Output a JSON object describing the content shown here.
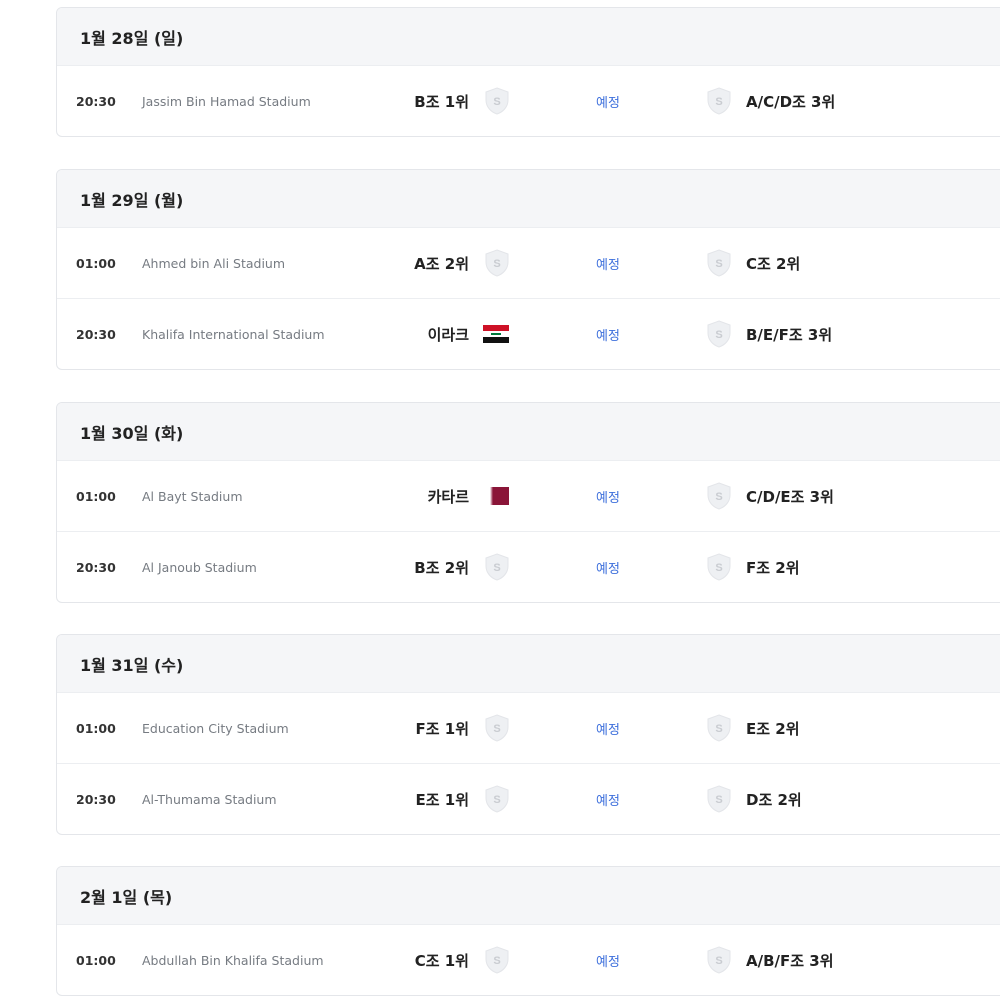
{
  "days": [
    {
      "date_label": "1월 28일 (일)",
      "matches": [
        {
          "time": "20:30",
          "stadium": "Jassim Bin Hamad Stadium",
          "home": "B조 1위",
          "home_icon": "shield-placeholder",
          "status": "예정",
          "away": "A/C/D조 3위",
          "away_icon": "shield-placeholder"
        }
      ]
    },
    {
      "date_label": "1월 29일 (월)",
      "matches": [
        {
          "time": "01:00",
          "stadium": "Ahmed bin Ali Stadium",
          "home": "A조 2위",
          "home_icon": "shield-placeholder",
          "status": "예정",
          "away": "C조 2위",
          "away_icon": "shield-placeholder"
        },
        {
          "time": "20:30",
          "stadium": "Khalifa International Stadium",
          "home": "이라크",
          "home_icon": "flag-iraq",
          "status": "예정",
          "away": "B/E/F조 3위",
          "away_icon": "shield-placeholder"
        }
      ]
    },
    {
      "date_label": "1월 30일 (화)",
      "matches": [
        {
          "time": "01:00",
          "stadium": "Al Bayt Stadium",
          "home": "카타르",
          "home_icon": "flag-qatar",
          "status": "예정",
          "away": "C/D/E조 3위",
          "away_icon": "shield-placeholder"
        },
        {
          "time": "20:30",
          "stadium": "Al Janoub Stadium",
          "home": "B조 2위",
          "home_icon": "shield-placeholder",
          "status": "예정",
          "away": "F조 2위",
          "away_icon": "shield-placeholder"
        }
      ]
    },
    {
      "date_label": "1월 31일 (수)",
      "matches": [
        {
          "time": "01:00",
          "stadium": "Education City Stadium",
          "home": "F조 1위",
          "home_icon": "shield-placeholder",
          "status": "예정",
          "away": "E조 2위",
          "away_icon": "shield-placeholder"
        },
        {
          "time": "20:30",
          "stadium": "Al-Thumama Stadium",
          "home": "E조 1위",
          "home_icon": "shield-placeholder",
          "status": "예정",
          "away": "D조 2위",
          "away_icon": "shield-placeholder"
        }
      ]
    },
    {
      "date_label": "2월 1일 (목)",
      "matches": [
        {
          "time": "01:00",
          "stadium": "Abdullah Bin Khalifa Stadium",
          "home": "C조 1위",
          "home_icon": "shield-placeholder",
          "status": "예정",
          "away": "A/B/F조 3위",
          "away_icon": "shield-placeholder"
        }
      ]
    }
  ],
  "colors": {
    "status_link": "#3d6fdc",
    "header_bg": "#f5f6f8",
    "shield_fill": "#eef0f3",
    "shield_letter": "#c9ccd1",
    "qatar_maroon": "#8a1538",
    "iraq_red": "#ce1126"
  }
}
